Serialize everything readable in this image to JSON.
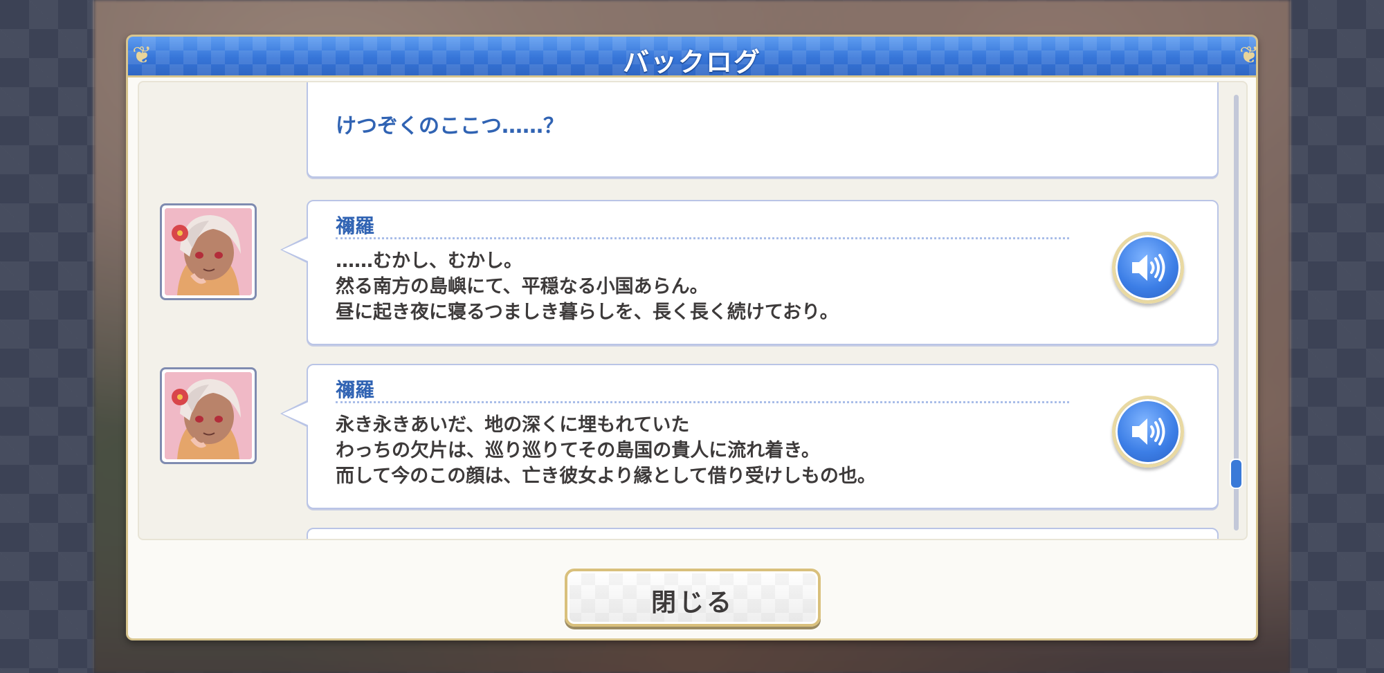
{
  "dialog": {
    "title": "バックログ",
    "close_label": "閉じる"
  },
  "log": {
    "entries": [
      {
        "speaker": "",
        "lines": [
          "けつぞくのここつ……？"
        ],
        "has_voice": false
      },
      {
        "speaker": "禰羅",
        "lines": [
          "……むかし、むかし。",
          "然る南方の島嶼にて、平穏なる小国あらん。",
          "昼に起き夜に寝るつましき暮らしを、長く長く続けており。"
        ],
        "has_voice": true,
        "avatar": "character-portrait"
      },
      {
        "speaker": "禰羅",
        "lines": [
          "永き永きあいだ、地の深くに埋もれていた",
          "わっちの欠片は、巡り巡りてその島国の貴人に流れ着き。",
          "而して今のこの顔は、亡き彼女より縁として借り受けしもの也。"
        ],
        "has_voice": true,
        "avatar": "character-portrait"
      }
    ]
  },
  "icons": {
    "voice": "speaker-volume-icon"
  },
  "colors": {
    "header_blue": "#3675d8",
    "name_blue": "#3063b3",
    "gold_border": "#d8c58e",
    "text_dark": "#3d3a3a"
  }
}
